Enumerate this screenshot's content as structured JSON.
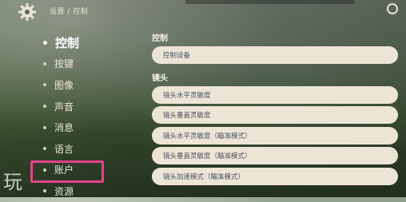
{
  "header": {
    "breadcrumb": "设置 / 控制",
    "settings_icon": "gear-icon"
  },
  "sidebar": {
    "items": [
      {
        "label": "控制",
        "active": true
      },
      {
        "label": "按键",
        "active": false
      },
      {
        "label": "图像",
        "active": false
      },
      {
        "label": "声音",
        "active": false
      },
      {
        "label": "消息",
        "active": false
      },
      {
        "label": "语言",
        "active": false
      },
      {
        "label": "账户",
        "active": false,
        "highlighted": true
      },
      {
        "label": "资源",
        "active": false
      }
    ]
  },
  "content": {
    "sections": [
      {
        "title": "控制",
        "rows": [
          "控制设备"
        ]
      },
      {
        "title": "镜头",
        "rows": [
          "镜头水平灵敏度",
          "镜头垂直灵敏度",
          "镜头水平灵敏度（瞄准模式）",
          "镜头垂直灵敏度（瞄准模式）",
          "镜头加速模式（瞄准模式）"
        ]
      }
    ]
  },
  "watermark": "玩",
  "colors": {
    "highlight": "#e8418a",
    "row_bg": "#ece5d6",
    "row_text": "#4a5060"
  }
}
